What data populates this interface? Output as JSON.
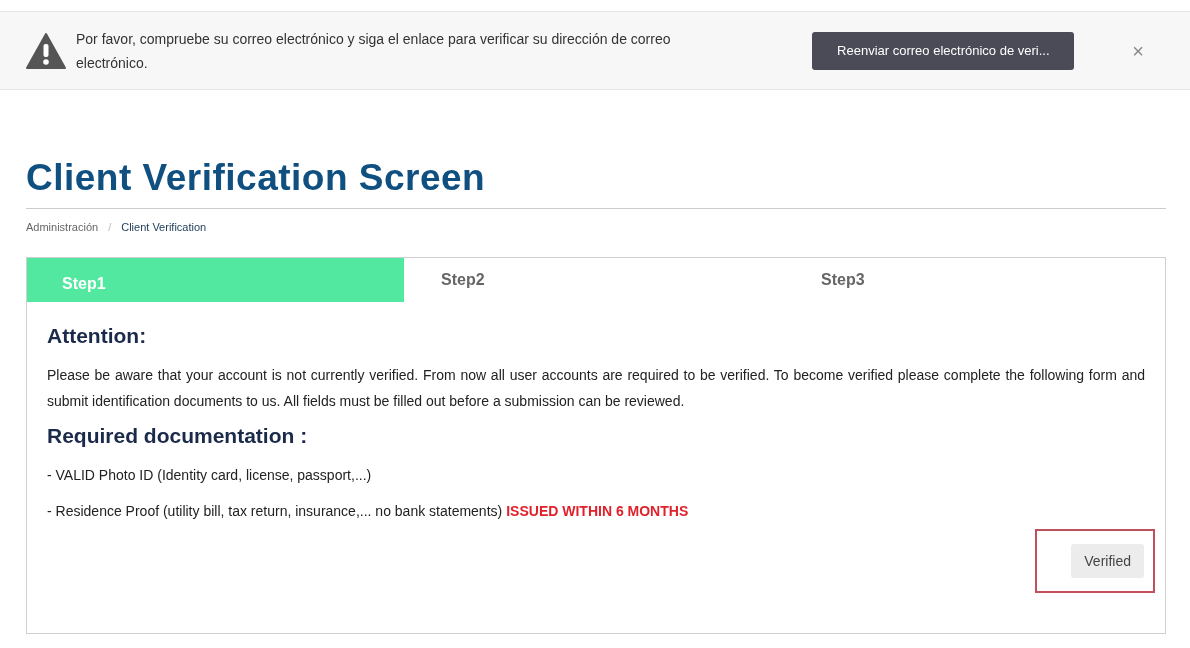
{
  "alert": {
    "message": "Por favor, compruebe su correo electrónico y siga el enlace para verificar su dirección de correo electrónico.",
    "button": "Reenviar correo electrónico de veri...",
    "close": "×"
  },
  "page_title": "Client Verification Screen",
  "breadcrumb_separator": "/",
  "breadcrumb": [
    {
      "label": "Administración",
      "current": false
    },
    {
      "label": "Client Verification",
      "current": true
    }
  ],
  "tabs": [
    {
      "label": "Step1",
      "selected": true
    },
    {
      "label": "Step2",
      "selected": false
    },
    {
      "label": "Step3",
      "selected": false
    }
  ],
  "attention": {
    "heading": "Attention:",
    "text": "Please be aware that your account is not currently verified. From now all user accounts are required to be verified. To become verified please complete the following form and submit identification documents to us. All fields must be filled out before a submission can be reviewed."
  },
  "documentation": {
    "heading": "Required documentation :",
    "items": [
      {
        "text": "- VALID Photo ID (Identity card, license, passport,...)"
      },
      {
        "text": "- Residence Proof (utility bill, tax return, insurance,... no bank statements)",
        "note": "ISSUED WITHIN 6 MONTHS"
      }
    ]
  },
  "status_button": {
    "label": "Verified",
    "highlighted": true
  }
}
